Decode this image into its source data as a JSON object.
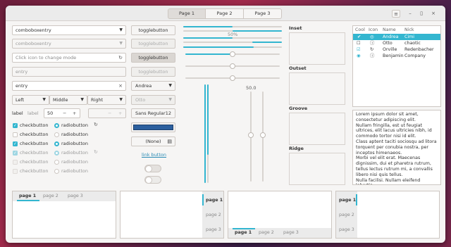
{
  "titlebar": {
    "tabs": [
      "Page 1",
      "Page 2",
      "Page 3"
    ],
    "menu_icon": "hamburger-icon",
    "minimize": "–",
    "maximize": "▯",
    "close": "×"
  },
  "col1": {
    "combo1": "comboboxentry",
    "combo2": "comboboxentry",
    "entry_icon_placeholder": "Click icon to change mode",
    "entry_disabled": "entry",
    "entry": "entry",
    "align_left": "Left",
    "align_middle": "Middle",
    "align_right": "Right",
    "spin_label": "label",
    "spin_label2": "label",
    "spin_value": "50",
    "minus": "−",
    "plus": "+",
    "checkbutton": "checkbutton",
    "radiobutton": "radiobutton"
  },
  "col2": {
    "togglebutton": "togglebutton",
    "combo_andrea": "Andrea",
    "combo_otto": "Otto",
    "font_name": "Sans Regular",
    "font_size": "12",
    "file_none": "(None)",
    "link": "link button",
    "color": "#2c5f9e"
  },
  "col3": {
    "progress_label": "50%",
    "scale_value": "50.0"
  },
  "frames": [
    "Inset",
    "Outset",
    "Groove",
    "Ridge"
  ],
  "treeview": {
    "headers": [
      "Cool",
      "Icon",
      "Name",
      "Nick"
    ],
    "rows": [
      {
        "name": "Andrea",
        "nick": "Cimi"
      },
      {
        "name": "Otto",
        "nick": "chaotic"
      },
      {
        "name": "Orville",
        "nick": "Redenbacher"
      },
      {
        "name": "Benjamin",
        "nick": "Company"
      }
    ]
  },
  "textview": {
    "lines": [
      "Lorem ipsum dolor sit amet,",
      "consectetur adipiscing elit.",
      "Nullam fringilla, est ut feugiat",
      "ultrices, elit lacus ultricies nibh, id",
      "commodo tortor nisi id elit.",
      "Class aptent taciti sociosqu ad litora",
      "torquent per conubia nostra, per",
      "inceptos himenaeos.",
      "Morbi vel elit erat. Maecenas",
      "dignissim, dui et pharetra rutrum,",
      "tellus lectus rutrum mi, a convallis",
      "libero nisi quis tellus.",
      "Nulla facilisi. Nullam eleifend lobortis",
      "nisl, in porttitor tellus malesuada"
    ]
  },
  "notebooks": {
    "pages": [
      "page 1",
      "page 2",
      "page 3"
    ]
  },
  "accent": "#33b6d0"
}
